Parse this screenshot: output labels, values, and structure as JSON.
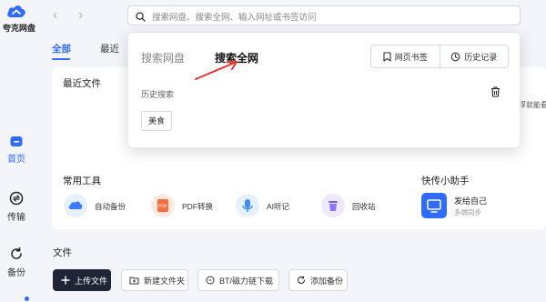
{
  "app": {
    "name": "夸克网盘"
  },
  "sidebar": {
    "items": [
      {
        "label": "首页",
        "icon": "home-icon",
        "active": true
      },
      {
        "label": "传输",
        "icon": "transfer-icon",
        "active": false
      },
      {
        "label": "备份",
        "icon": "backup-icon",
        "active": false
      }
    ]
  },
  "topbar": {
    "search_placeholder": "搜索网盘、搜索全网、输入网址或书签访问"
  },
  "tabs": [
    {
      "label": "全部",
      "active": true
    },
    {
      "label": "最近",
      "active": false
    }
  ],
  "sections": {
    "recent_files": "最近文件",
    "tools": "常用工具",
    "assistant": "快传小助手",
    "files": "文件"
  },
  "tools": [
    {
      "label": "自动备份",
      "icon": "auto-backup-icon",
      "color": "#e7f0ff"
    },
    {
      "label": "PDF转换",
      "icon": "pdf-icon",
      "color": "#ffe9e3"
    },
    {
      "label": "AI听记",
      "icon": "mic-icon",
      "color": "#e6f1ff"
    },
    {
      "label": "回收站",
      "icon": "recycle-bin-icon",
      "color": "#efe9ff"
    }
  ],
  "assistant": {
    "title": "发给自己",
    "subtitle": "多端同步",
    "snippet": "浮就能看"
  },
  "file_actions": [
    {
      "label": "上传文件",
      "icon": "plus-icon",
      "primary": true
    },
    {
      "label": "新建文件夹",
      "icon": "new-folder-icon",
      "primary": false
    },
    {
      "label": "BT/磁力链下载",
      "icon": "bt-icon",
      "primary": false
    },
    {
      "label": "添加备份",
      "icon": "sync-icon",
      "primary": false
    }
  ],
  "popover": {
    "tab_disk": "搜索网盘",
    "tab_web": "搜索全网",
    "bookmarks_button": "网页书签",
    "history_button": "历史记录",
    "history_label": "历史搜索",
    "history_items": [
      "美食"
    ]
  },
  "colors": {
    "accent": "#2f6bff",
    "primary_button": "#1f2535",
    "annotation": "#e53935"
  }
}
